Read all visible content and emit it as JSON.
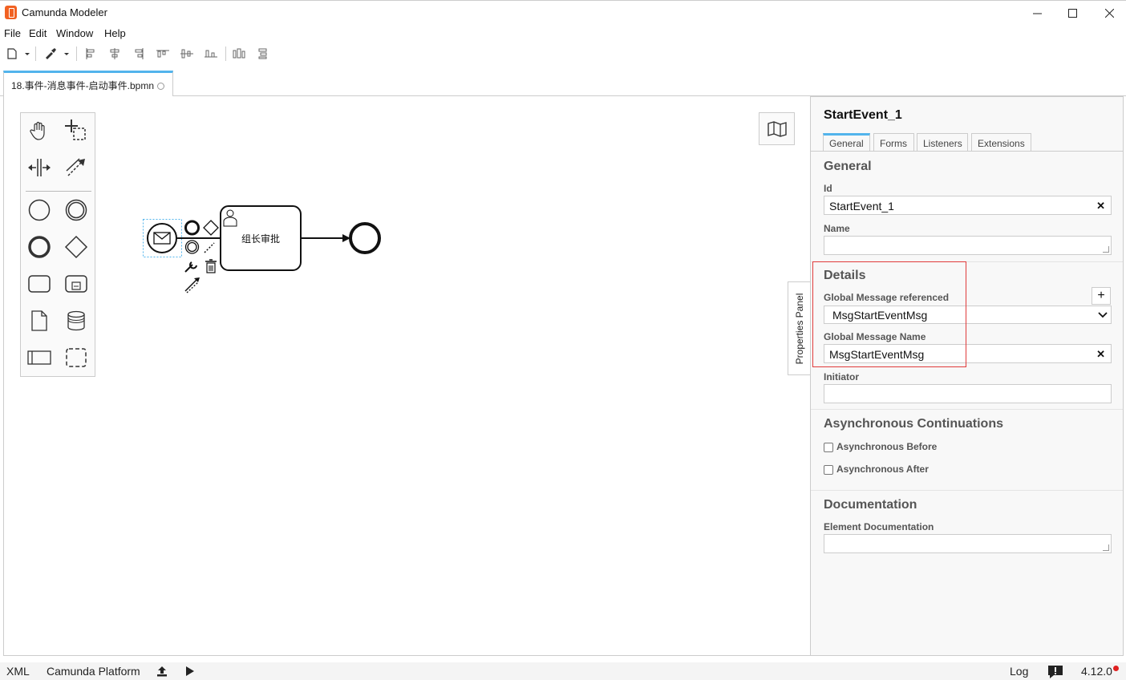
{
  "window": {
    "title": "Camunda Modeler"
  },
  "menu": [
    "File",
    "Edit",
    "Window",
    "Help"
  ],
  "tab": {
    "filename": "18.事件-消息事件-启动事件.bpmn"
  },
  "diagram": {
    "task_label": "组长审批"
  },
  "properties_toggle": "Properties Panel",
  "properties": {
    "element_title": "StartEvent_1",
    "tabs": [
      "General",
      "Forms",
      "Listeners",
      "Extensions"
    ],
    "general": {
      "title": "General",
      "id_label": "Id",
      "id_value": "StartEvent_1",
      "name_label": "Name",
      "name_value": ""
    },
    "details": {
      "title": "Details",
      "global_message_referenced_label": "Global Message referenced",
      "global_message_referenced_value": "MsgStartEventMsg",
      "global_message_name_label": "Global Message Name",
      "global_message_name_value": "MsgStartEventMsg",
      "initiator_label": "Initiator",
      "initiator_value": ""
    },
    "async": {
      "title": "Asynchronous Continuations",
      "before_label": "Asynchronous Before",
      "after_label": "Asynchronous After"
    },
    "documentation": {
      "title": "Documentation",
      "element_doc_label": "Element Documentation",
      "element_doc_value": ""
    }
  },
  "statusbar": {
    "xml": "XML",
    "platform": "Camunda Platform",
    "log": "Log",
    "version": "4.12.0"
  },
  "colors": {
    "accent": "#52b4ec",
    "highlight": "#e03b3b",
    "logo": "#f16122"
  }
}
